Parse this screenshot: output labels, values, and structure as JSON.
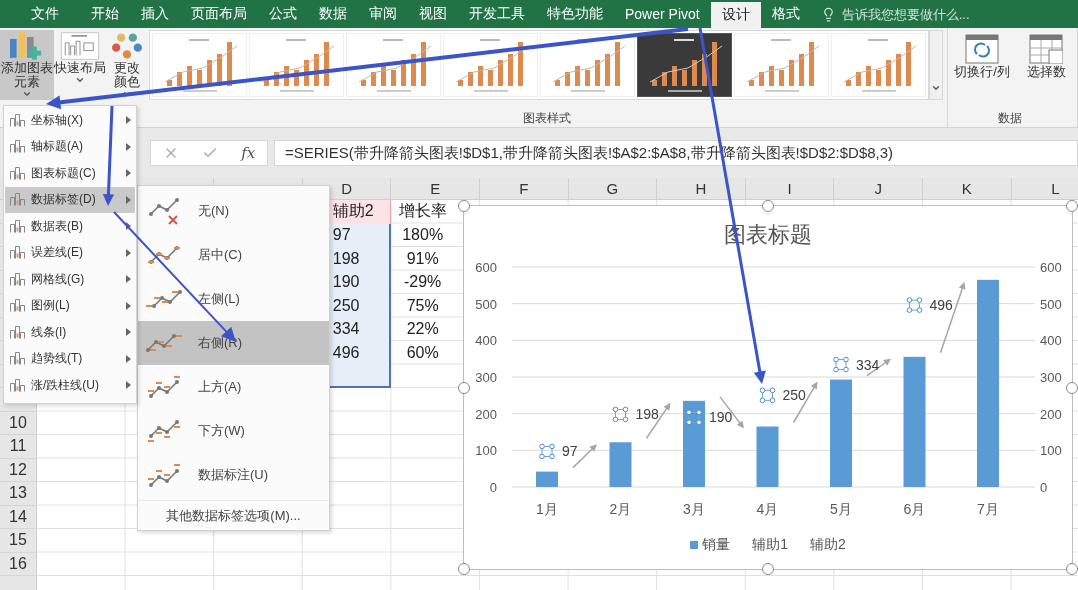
{
  "ribbon": {
    "tabs": [
      {
        "label": "文件",
        "selected": false
      },
      {
        "label": "开始",
        "selected": false
      },
      {
        "label": "插入",
        "selected": false
      },
      {
        "label": "页面布局",
        "selected": false
      },
      {
        "label": "公式",
        "selected": false
      },
      {
        "label": "数据",
        "selected": false
      },
      {
        "label": "审阅",
        "selected": false
      },
      {
        "label": "视图",
        "selected": false
      },
      {
        "label": "开发工具",
        "selected": false
      },
      {
        "label": "特色功能",
        "selected": false
      },
      {
        "label": "Power Pivot",
        "selected": false
      },
      {
        "label": "设计",
        "selected": true
      },
      {
        "label": "格式",
        "selected": false
      }
    ],
    "tell_me": {
      "placeholder": "告诉我您想要做什么..."
    },
    "layout_buttons": [
      {
        "label": "添加图表元素",
        "kind": "elements",
        "pressed": true
      },
      {
        "label": "快速布局",
        "kind": "layout",
        "pressed": false
      },
      {
        "label": "更改颜色",
        "kind": "colors",
        "pressed": false
      }
    ],
    "styles": {
      "items": [
        {
          "kind": "light"
        },
        {
          "kind": "light"
        },
        {
          "kind": "light"
        },
        {
          "kind": "light"
        },
        {
          "kind": "light"
        },
        {
          "kind": "dark"
        },
        {
          "kind": "light"
        },
        {
          "kind": "light"
        }
      ],
      "group_label": "图表样式"
    },
    "data_group": {
      "buttons": [
        {
          "label": "切换行/列",
          "kind": "switch"
        },
        {
          "label": "选择数",
          "kind": "select"
        }
      ],
      "group_label": "数据"
    }
  },
  "formula_bar": {
    "function_button": "fx",
    "formula": "=SERIES(带升降箭头图表!$D$1,带升降箭头图表!$A$2:$A$8,带升降箭头图表!$D$2:$D$8,3)"
  },
  "sheet": {
    "columns": [
      "D",
      "E",
      "F",
      "G",
      "H",
      "I",
      "J",
      "K",
      "L"
    ],
    "row_numbers": [
      "10",
      "11",
      "12",
      "13",
      "14",
      "15",
      "16"
    ],
    "data_rows": [
      {
        "cells": [
          {
            "text": "辅助2",
            "kind": "name"
          },
          {
            "text": "增长率",
            "kind": "plain"
          }
        ]
      },
      {
        "cells": [
          {
            "text": "97",
            "kind": "values"
          },
          {
            "text": "180%",
            "kind": "plain"
          }
        ]
      },
      {
        "cells": [
          {
            "text": "198",
            "kind": "values"
          },
          {
            "text": "91%",
            "kind": "plain"
          }
        ]
      },
      {
        "cells": [
          {
            "text": "190",
            "kind": "values"
          },
          {
            "text": "-29%",
            "kind": "plain"
          }
        ]
      },
      {
        "cells": [
          {
            "text": "250",
            "kind": "values"
          },
          {
            "text": "75%",
            "kind": "plain"
          }
        ]
      },
      {
        "cells": [
          {
            "text": "334",
            "kind": "values"
          },
          {
            "text": "22%",
            "kind": "plain"
          }
        ]
      },
      {
        "cells": [
          {
            "text": "496",
            "kind": "values"
          },
          {
            "text": "60%",
            "kind": "plain"
          }
        ]
      },
      {
        "cells": [
          {
            "kind": "values"
          }
        ]
      }
    ]
  },
  "chart": {
    "chart_data": {
      "type": "bar",
      "title": "图表标题",
      "categories": [
        "1月",
        "2月",
        "3月",
        "4月",
        "5月",
        "6月",
        "7月"
      ],
      "series": [
        {
          "name": "销量",
          "color": "#5b9bd5",
          "values": [
            42,
            122,
            235,
            165,
            293,
            355,
            565
          ]
        }
      ],
      "ylim": [
        0,
        600
      ],
      "yticks": [
        0,
        100,
        200,
        300,
        400,
        500,
        600
      ],
      "grid": true,
      "annotations": [
        {
          "text": "97",
          "x": "1月",
          "y": 97
        },
        {
          "text": "198",
          "x": "2月",
          "y": 198
        },
        {
          "text": "190",
          "x": "3月",
          "y": 190
        },
        {
          "text": "250",
          "x": "4月",
          "y": 250
        },
        {
          "text": "334",
          "x": "5月",
          "y": 334
        },
        {
          "text": "496",
          "x": "6月",
          "y": 496
        }
      ]
    },
    "right_axis_labels": [
      "600",
      "500",
      "400",
      "300",
      "200",
      "100",
      "0"
    ],
    "legend": [
      {
        "label": "辅助1"
      },
      {
        "label": "辅助2"
      }
    ]
  },
  "elements_menu": {
    "items": [
      {
        "label": "坐标轴(X)",
        "selected": false
      },
      {
        "label": "轴标题(A)",
        "selected": false
      },
      {
        "label": "图表标题(C)",
        "selected": false
      },
      {
        "label": "数据标签(D)",
        "selected": true
      },
      {
        "label": "数据表(B)",
        "selected": false
      },
      {
        "label": "误差线(E)",
        "selected": false
      },
      {
        "label": "网格线(G)",
        "selected": false
      },
      {
        "label": "图例(L)",
        "selected": false
      },
      {
        "label": "线条(I)",
        "selected": false
      },
      {
        "label": "趋势线(T)",
        "selected": false
      },
      {
        "label": "涨/跌柱线(U)",
        "selected": false
      }
    ]
  },
  "labels_submenu": {
    "items": [
      {
        "label": "无(N)",
        "kind": "none",
        "selected": false
      },
      {
        "label": "居中(C)",
        "kind": "center",
        "selected": false
      },
      {
        "label": "左侧(L)",
        "kind": "left",
        "selected": false
      },
      {
        "label": "右侧(R)",
        "kind": "right",
        "selected": true
      },
      {
        "label": "上方(A)",
        "kind": "above",
        "selected": false
      },
      {
        "label": "下方(W)",
        "kind": "below",
        "selected": false
      },
      {
        "label": "数据标注(U)",
        "kind": "callout",
        "selected": false
      }
    ],
    "more": "其他数据标签选项(M)..."
  }
}
